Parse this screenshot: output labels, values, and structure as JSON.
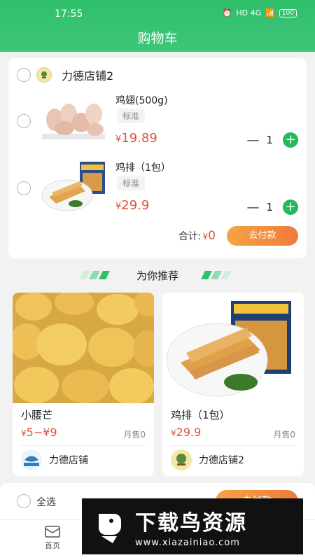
{
  "status_bar": {
    "time": "17:55",
    "signal": "HD 4G",
    "battery": "100"
  },
  "header": {
    "title": "购物车"
  },
  "cart": {
    "store": {
      "name": "力德店铺2"
    },
    "items": [
      {
        "name": "鸡翅(500g)",
        "spec": "标准",
        "currency": "¥",
        "price": "19.89",
        "quantity": "1",
        "minus": "—",
        "plus": "+"
      },
      {
        "name": "鸡排（1包）",
        "spec": "标准",
        "currency": "¥",
        "price": "29.9",
        "quantity": "1",
        "minus": "—",
        "plus": "+"
      }
    ],
    "total_label": "合计:",
    "total_currency": "¥",
    "total_value": "0",
    "pay_label": "去付款"
  },
  "recommend": {
    "title": "为你推荐",
    "products": [
      {
        "name": "小腰芒",
        "currency": "¥",
        "price": "5~¥9",
        "sold": "月售0",
        "store": "力德店铺"
      },
      {
        "name": "鸡排（1包）",
        "currency": "¥",
        "price": "29.9",
        "sold": "月售0",
        "store": "力德店铺2"
      }
    ]
  },
  "bottom_bar": {
    "select_all": "全选",
    "pay_label": "去付款"
  },
  "tabbar": {
    "home_label": "首页"
  },
  "watermark": {
    "title": "下载鸟资源",
    "url": "www.xiazainiao.com"
  },
  "colors": {
    "brand_green": "#2fbf6b",
    "price_red": "#e0513a",
    "pay_orange": "#f07a3c"
  }
}
